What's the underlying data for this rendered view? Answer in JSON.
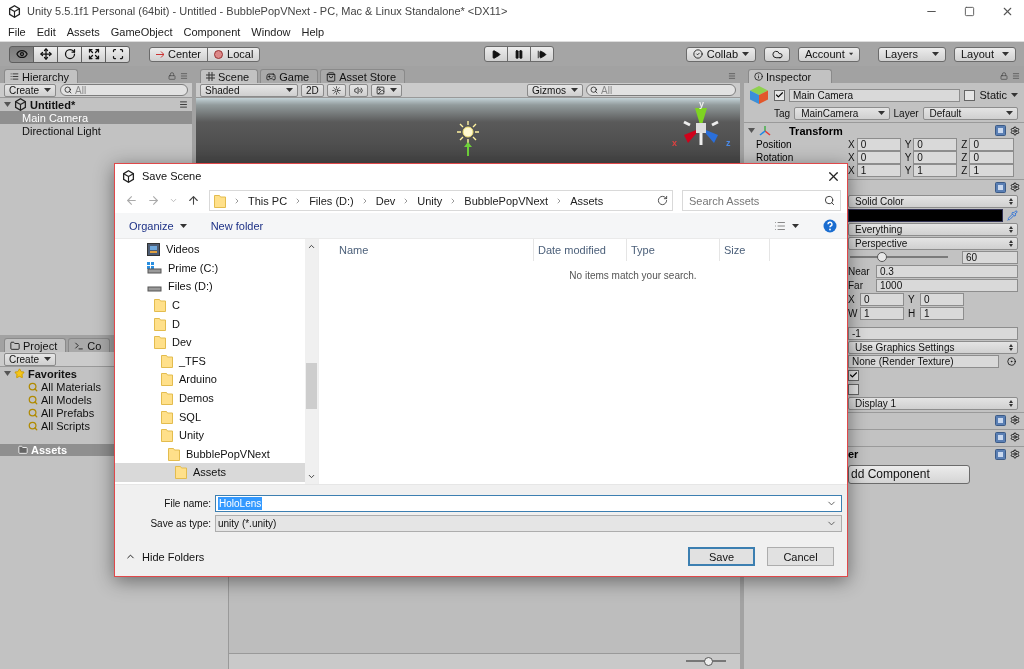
{
  "window": {
    "title": "Unity 5.5.1f1 Personal (64bit) - Untitled - BubblePopVNext - PC, Mac & Linux Standalone* <DX11>"
  },
  "menu": [
    "File",
    "Edit",
    "Assets",
    "GameObject",
    "Component",
    "Window",
    "Help"
  ],
  "toolbar": {
    "tools": [
      {
        "kind": "view",
        "selected": true
      },
      {
        "kind": "move",
        "selected": false
      },
      {
        "kind": "rotate",
        "selected": false
      },
      {
        "kind": "scale",
        "selected": false
      },
      {
        "kind": "rect",
        "selected": false
      }
    ],
    "pivot": "Center",
    "space": "Local",
    "collab": "Collab",
    "account": "Account",
    "layers": "Layers",
    "layout": "Layout"
  },
  "hierarchy": {
    "tab": "Hierarchy",
    "create": "Create",
    "search": {
      "placeholder": "All"
    },
    "items": [
      {
        "name": "Untitled*",
        "kind": "scene",
        "expanded": true,
        "selected": false,
        "children": [
          {
            "name": "Main Camera",
            "selected": true
          },
          {
            "name": "Directional Light",
            "selected": false
          }
        ]
      }
    ]
  },
  "scene_view": {
    "tabs": [
      {
        "label": "Scene",
        "kind": "scene",
        "selected": true
      },
      {
        "label": "Game",
        "kind": "game",
        "selected": false
      },
      {
        "label": "Asset Store",
        "kind": "store",
        "selected": false
      }
    ],
    "shading": "Shaded",
    "two_d": "2D",
    "lighting": {
      "on": false
    },
    "audio": {
      "on": false
    },
    "gizmos": "Gizmos",
    "search": {
      "placeholder": "All"
    },
    "axes": [
      "y",
      "x",
      "z"
    ]
  },
  "project": {
    "tabs": [
      {
        "label": "Project",
        "kind": "project",
        "selected": true
      },
      {
        "label": "Co",
        "kind": "console",
        "selected": false
      }
    ],
    "create": "Create",
    "favorites": {
      "name": "Favorites",
      "expanded": true,
      "children": [
        {
          "name": "All Materials",
          "selected": false
        },
        {
          "name": "All Models",
          "selected": false
        },
        {
          "name": "All Prefabs",
          "selected": false
        },
        {
          "name": "All Scripts",
          "selected": false
        }
      ]
    },
    "assets": {
      "name": "Assets",
      "selected": true
    },
    "icon_size": {
      "level": 0.55
    }
  },
  "inspector": {
    "tab": "Inspector",
    "object": {
      "enabled": true,
      "name": "Main Camera",
      "static_label": "Static",
      "static": false,
      "tag_label": "Tag",
      "tag": "MainCamera",
      "layer_label": "Layer",
      "layer": "Default"
    },
    "transform": {
      "title": "Transform",
      "expanded": true,
      "rows": [
        {
          "label": "Position",
          "values": [
            {
              "axis": "X",
              "value": "0"
            },
            {
              "axis": "Y",
              "value": "0"
            },
            {
              "axis": "Z",
              "value": "0"
            }
          ]
        },
        {
          "label": "Rotation",
          "values": [
            {
              "axis": "X",
              "value": "0"
            },
            {
              "axis": "Y",
              "value": "0"
            },
            {
              "axis": "Z",
              "value": "0"
            }
          ]
        },
        {
          "values": [
            {
              "axis": "X",
              "value": "1"
            },
            {
              "axis": "Y",
              "value": "1"
            },
            {
              "axis": "Z",
              "value": "1"
            }
          ]
        }
      ]
    },
    "camera_fields": [
      {
        "kind": "header"
      },
      {
        "kind": "dropdown",
        "value": "Solid Color"
      },
      {
        "kind": "color",
        "color": "#000000"
      },
      {
        "kind": "dropdown",
        "value": "Everything"
      },
      {
        "kind": "dropdown",
        "value": "Perspective"
      },
      {
        "kind": "slider",
        "level": 0.33,
        "reading": "60"
      },
      {
        "kind": "pair",
        "items": [
          {
            "label": "Near",
            "value": "0.3"
          }
        ]
      },
      {
        "kind": "pair",
        "items": [
          {
            "label": "Far",
            "value": "1000"
          }
        ]
      },
      {
        "kind": "pair",
        "items": [
          {
            "label": "X",
            "value": "0"
          },
          {
            "label": "Y",
            "value": "0"
          }
        ]
      },
      {
        "kind": "pair",
        "items": [
          {
            "label": "W",
            "value": "1"
          },
          {
            "label": "H",
            "value": "1"
          }
        ]
      },
      {
        "kind": "text",
        "value": "-1"
      },
      {
        "kind": "dropdown",
        "value": "Use Graphics Settings"
      },
      {
        "kind": "object",
        "value": "None (Render Texture)"
      },
      {
        "kind": "checkbox",
        "checked": true
      },
      {
        "kind": "checkbox",
        "checked": false
      },
      {
        "kind": "dropdown",
        "value": "Display 1"
      },
      {
        "kind": "header"
      },
      {
        "kind": "header"
      },
      {
        "kind": "header",
        "title": "er"
      },
      {
        "kind": "button",
        "label": "dd Component"
      }
    ]
  },
  "dialog": {
    "title": "Save Scene",
    "breadcrumb": [
      "This PC",
      "Files (D:)",
      "Dev",
      "Unity",
      "BubblePopVNext",
      "Assets"
    ],
    "search": {
      "placeholder": "Search Assets"
    },
    "organize": "Organize",
    "new_folder": "New folder",
    "tree": [
      {
        "label": "Videos",
        "kind": "videos",
        "selected": false
      },
      {
        "label": "Prime (C:)",
        "kind": "system_drive",
        "selected": false
      },
      {
        "label": "Files (D:)",
        "kind": "drive",
        "selected": false,
        "children": [
          {
            "label": "C",
            "kind": "folder",
            "selected": false
          },
          {
            "label": "D",
            "kind": "folder",
            "selected": false
          },
          {
            "label": "Dev",
            "kind": "folder",
            "selected": false,
            "children": [
              {
                "label": "_TFS",
                "kind": "folder",
                "selected": false
              },
              {
                "label": "Arduino",
                "kind": "folder",
                "selected": false
              },
              {
                "label": "Demos",
                "kind": "folder",
                "selected": false
              },
              {
                "label": "SQL",
                "kind": "folder",
                "selected": false
              },
              {
                "label": "Unity",
                "kind": "folder",
                "selected": false,
                "children": [
                  {
                    "label": "BubblePopVNext",
                    "kind": "folder",
                    "selected": false,
                    "children": [
                      {
                        "label": "Assets",
                        "kind": "folder",
                        "selected": true
                      }
                    ]
                  }
                ]
              }
            ]
          }
        ]
      }
    ],
    "columns": [
      "Name",
      "Date modified",
      "Type",
      "Size"
    ],
    "empty_message": "No items match your search.",
    "file_name": {
      "label": "File name:",
      "value": "HoloLens"
    },
    "save_as_type": {
      "label": "Save as type:",
      "value": "unity (*.unity)"
    },
    "hide_folders": "Hide Folders",
    "buttons": [
      {
        "label": "Save",
        "default": true
      },
      {
        "label": "Cancel",
        "default": false
      }
    ]
  }
}
